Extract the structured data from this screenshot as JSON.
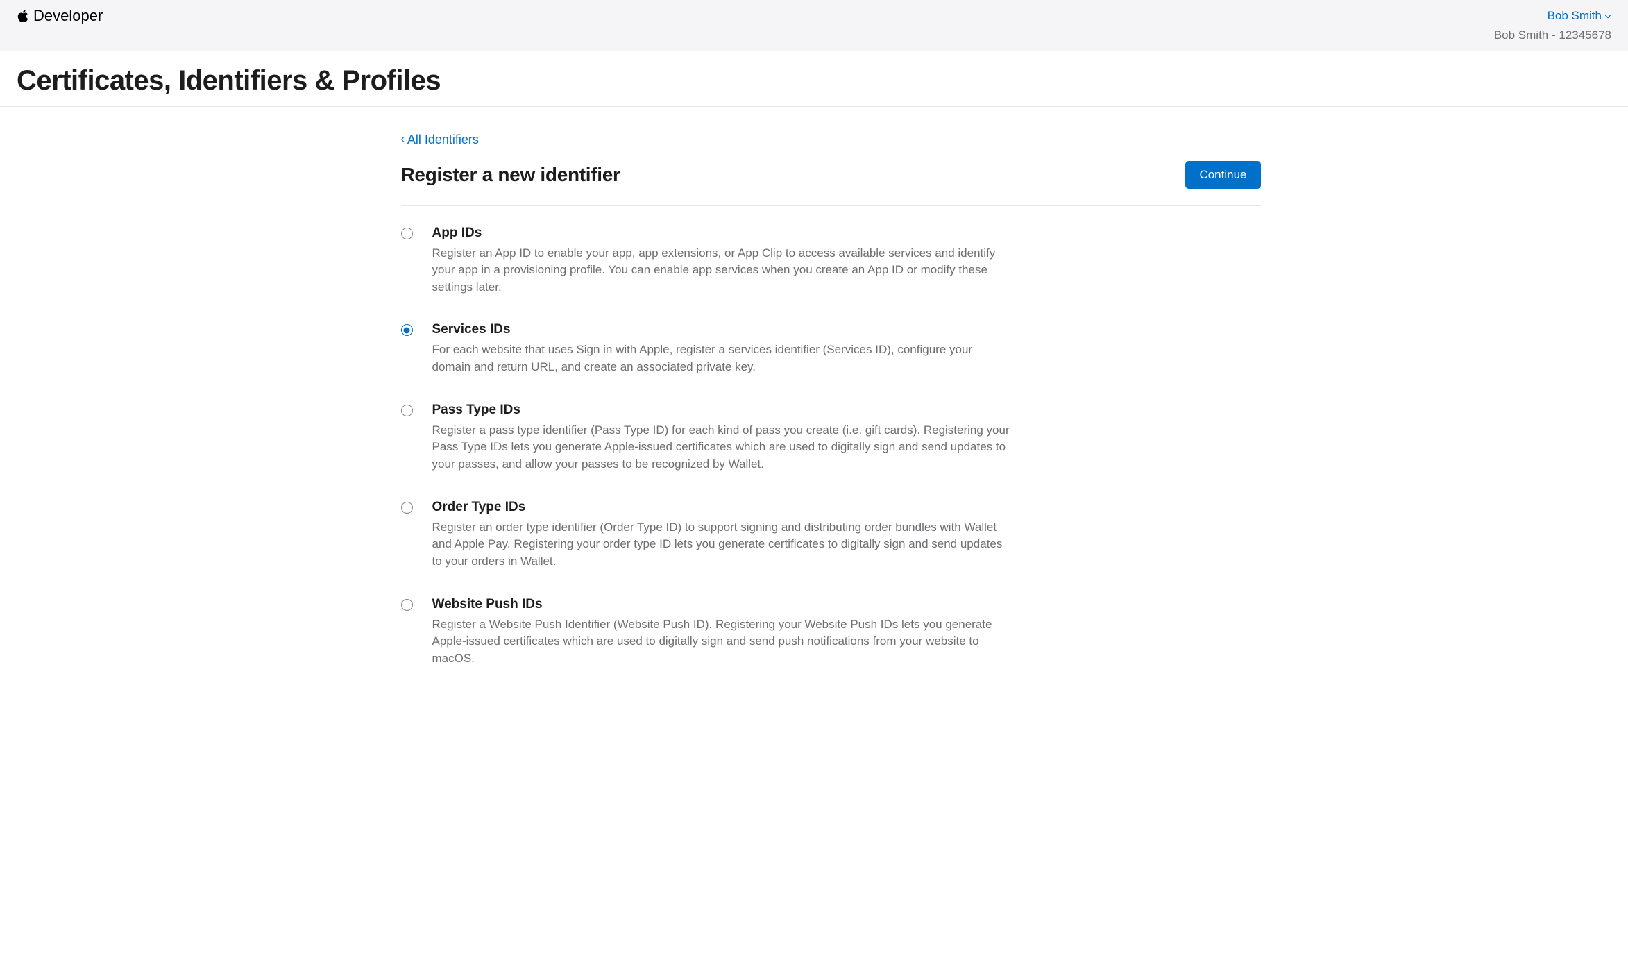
{
  "header": {
    "brand": "Developer",
    "account_name": "Bob Smith",
    "account_team": "Bob Smith - 12345678"
  },
  "page": {
    "title": "Certificates, Identifiers & Profiles",
    "back_label": "All Identifiers",
    "section_title": "Register a new identifier",
    "continue_label": "Continue"
  },
  "options": [
    {
      "id": "app-ids",
      "title": "App IDs",
      "description": "Register an App ID to enable your app, app extensions, or App Clip to access available services and identify your app in a provisioning profile. You can enable app services when you create an App ID or modify these settings later.",
      "selected": false
    },
    {
      "id": "services-ids",
      "title": "Services IDs",
      "description": "For each website that uses Sign in with Apple, register a services identifier (Services ID), configure your domain and return URL, and create an associated private key.",
      "selected": true
    },
    {
      "id": "pass-type-ids",
      "title": "Pass Type IDs",
      "description": "Register a pass type identifier (Pass Type ID) for each kind of pass you create (i.e. gift cards). Registering your Pass Type IDs lets you generate Apple-issued certificates which are used to digitally sign and send updates to your passes, and allow your passes to be recognized by Wallet.",
      "selected": false
    },
    {
      "id": "order-type-ids",
      "title": "Order Type IDs",
      "description": "Register an order type identifier (Order Type ID) to support signing and distributing order bundles with Wallet and Apple Pay. Registering your order type ID lets you generate certificates to digitally sign and send updates to your orders in Wallet.",
      "selected": false
    },
    {
      "id": "website-push-ids",
      "title": "Website Push IDs",
      "description": "Register a Website Push Identifier (Website Push ID). Registering your Website Push IDs lets you generate Apple-issued certificates which are used to digitally sign and send push notifications from your website to macOS.",
      "selected": false
    }
  ]
}
